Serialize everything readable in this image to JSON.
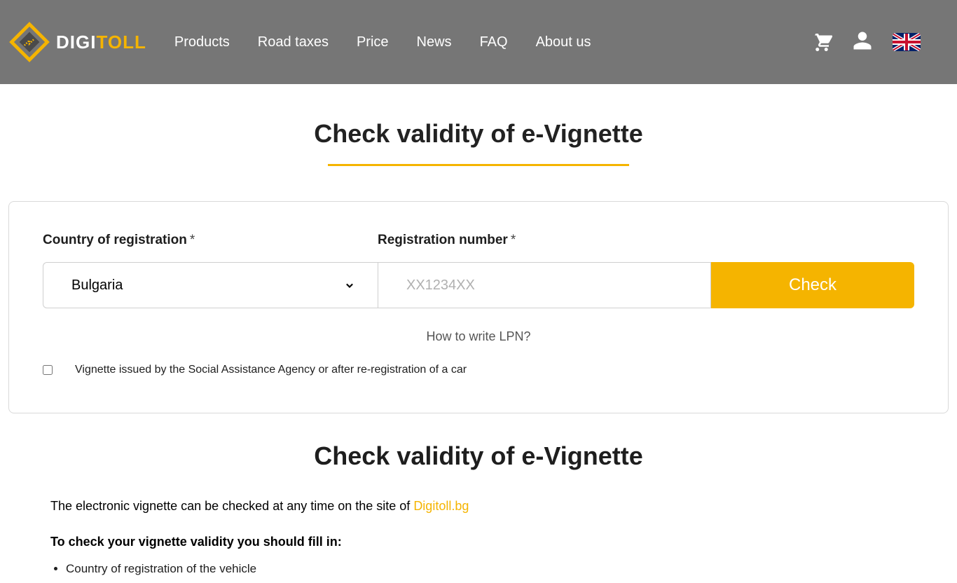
{
  "brand": {
    "p1": "DIGI",
    "p2": "TOLL"
  },
  "nav": {
    "products": "Products",
    "roadtaxes": "Road taxes",
    "price": "Price",
    "news": "News",
    "faq": "FAQ",
    "about": "About us"
  },
  "page_title": "Check validity of e-Vignette",
  "form": {
    "country_label": "Country of registration",
    "reg_label": "Registration number",
    "required_mark": "*",
    "country_value": "Bulgaria",
    "reg_placeholder": "XX1234XX",
    "check_button": "Check",
    "lpn_link": "How to write LPN?",
    "social_checkbox_label": "Vignette issued by the Social Assistance Agency or after re-registration of a car"
  },
  "info": {
    "title": "Check validity of e-Vignette",
    "intro_prefix": "The electronic vignette can be checked at any time on the site of ",
    "intro_link": "Digitoll.bg",
    "instructions_head": "To check your vignette validity you should fill in:",
    "bullets": [
      "Country of registration of the vehicle"
    ]
  }
}
